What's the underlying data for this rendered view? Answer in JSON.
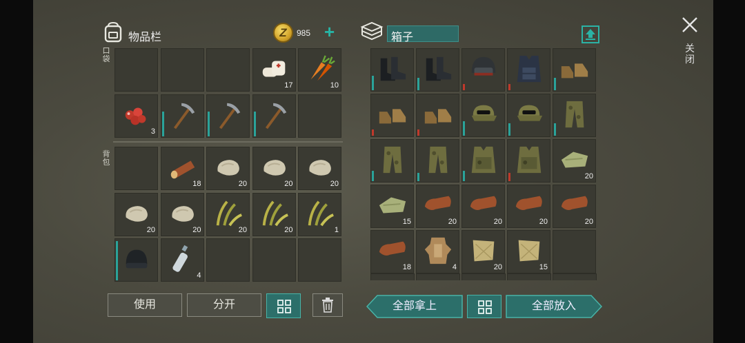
{
  "inventory": {
    "title": "物品栏",
    "coins": "985",
    "pocket_label": "口袋",
    "backpack_label": "背包",
    "pocket_slots": [
      {
        "item": "",
        "count": ""
      },
      {
        "item": "",
        "count": ""
      },
      {
        "item": "",
        "count": ""
      },
      {
        "item": "bandage-icon",
        "count": "17"
      },
      {
        "item": "carrot-icon",
        "count": "10"
      },
      {
        "item": "berries-icon",
        "count": "3"
      },
      {
        "item": "pickaxe-icon",
        "count": "",
        "durability": 0.6
      },
      {
        "item": "pickaxe-icon",
        "count": "",
        "durability": 0.6
      },
      {
        "item": "pickaxe-icon",
        "count": "",
        "durability": 0.6
      },
      {
        "item": "",
        "count": ""
      }
    ],
    "backpack_slots": [
      {
        "item": "",
        "count": ""
      },
      {
        "item": "log-icon",
        "count": "18"
      },
      {
        "item": "stone-icon",
        "count": "20"
      },
      {
        "item": "stone-icon",
        "count": "20"
      },
      {
        "item": "stone-icon",
        "count": "20"
      },
      {
        "item": "stone-icon",
        "count": "20"
      },
      {
        "item": "stone-icon",
        "count": "20"
      },
      {
        "item": "plant-fiber-icon",
        "count": "20"
      },
      {
        "item": "plant-fiber-icon",
        "count": "20"
      },
      {
        "item": "plant-fiber-icon",
        "count": "1"
      },
      {
        "item": "beanie-icon",
        "count": "",
        "durability": 0.95
      },
      {
        "item": "water-bottle-icon",
        "count": "4"
      },
      {
        "item": "",
        "count": ""
      },
      {
        "item": "",
        "count": ""
      },
      {
        "item": "",
        "count": ""
      }
    ],
    "buttons": {
      "use": "使用",
      "split": "分开"
    }
  },
  "box": {
    "title": "箱子",
    "slots": [
      {
        "item": "black-boots-icon",
        "count": "",
        "durability": 0.35,
        "dur_color": "#2aa39a"
      },
      {
        "item": "black-boots-icon",
        "count": "",
        "durability": 0.3,
        "dur_color": "#2aa39a"
      },
      {
        "item": "helmet-icon",
        "count": "",
        "durability": 0.15,
        "dur_color": "#c0392b"
      },
      {
        "item": "tactical-vest-icon",
        "count": "",
        "durability": 0.15,
        "dur_color": "#c0392b"
      },
      {
        "item": "brown-boots-icon",
        "count": "",
        "durability": 0.3,
        "dur_color": "#2aa39a"
      },
      {
        "item": "brown-boots-icon",
        "count": "",
        "durability": 0.15,
        "dur_color": "#c0392b"
      },
      {
        "item": "brown-boots-icon",
        "count": "",
        "durability": 0.15,
        "dur_color": "#c0392b"
      },
      {
        "item": "camo-cap-icon",
        "count": "",
        "durability": 0.35,
        "dur_color": "#2aa39a"
      },
      {
        "item": "camo-cap-icon",
        "count": "",
        "durability": 0.3,
        "dur_color": "#2aa39a"
      },
      {
        "item": "camo-pants-icon",
        "count": "",
        "durability": 0.3,
        "dur_color": "#2aa39a"
      },
      {
        "item": "camo-pants-icon",
        "count": "",
        "durability": 0.25,
        "dur_color": "#2aa39a"
      },
      {
        "item": "camo-pants-icon",
        "count": "",
        "durability": 0.2,
        "dur_color": "#2aa39a"
      },
      {
        "item": "camo-vest-icon",
        "count": "",
        "durability": 0.25,
        "dur_color": "#2aa39a"
      },
      {
        "item": "camo-vest-icon",
        "count": "",
        "durability": 0.2,
        "dur_color": "#c0392b"
      },
      {
        "item": "cloth-icon",
        "count": "20"
      },
      {
        "item": "cloth-icon",
        "count": "15"
      },
      {
        "item": "leather-icon",
        "count": "20"
      },
      {
        "item": "leather-icon",
        "count": "20"
      },
      {
        "item": "leather-icon",
        "count": "20"
      },
      {
        "item": "leather-icon",
        "count": "20"
      },
      {
        "item": "leather-icon",
        "count": "18"
      },
      {
        "item": "animal-hide-icon",
        "count": "4"
      },
      {
        "item": "burlap-icon",
        "count": "20"
      },
      {
        "item": "burlap-icon",
        "count": "15"
      },
      {
        "item": "",
        "count": ""
      }
    ],
    "buttons": {
      "take_all": "全部拿上",
      "put_all": "全部放入"
    }
  },
  "close_label": "关闭",
  "colors": {
    "accent": "#2bb3a5",
    "panel": "#3a3a32",
    "bg": "#4b4a3f"
  }
}
